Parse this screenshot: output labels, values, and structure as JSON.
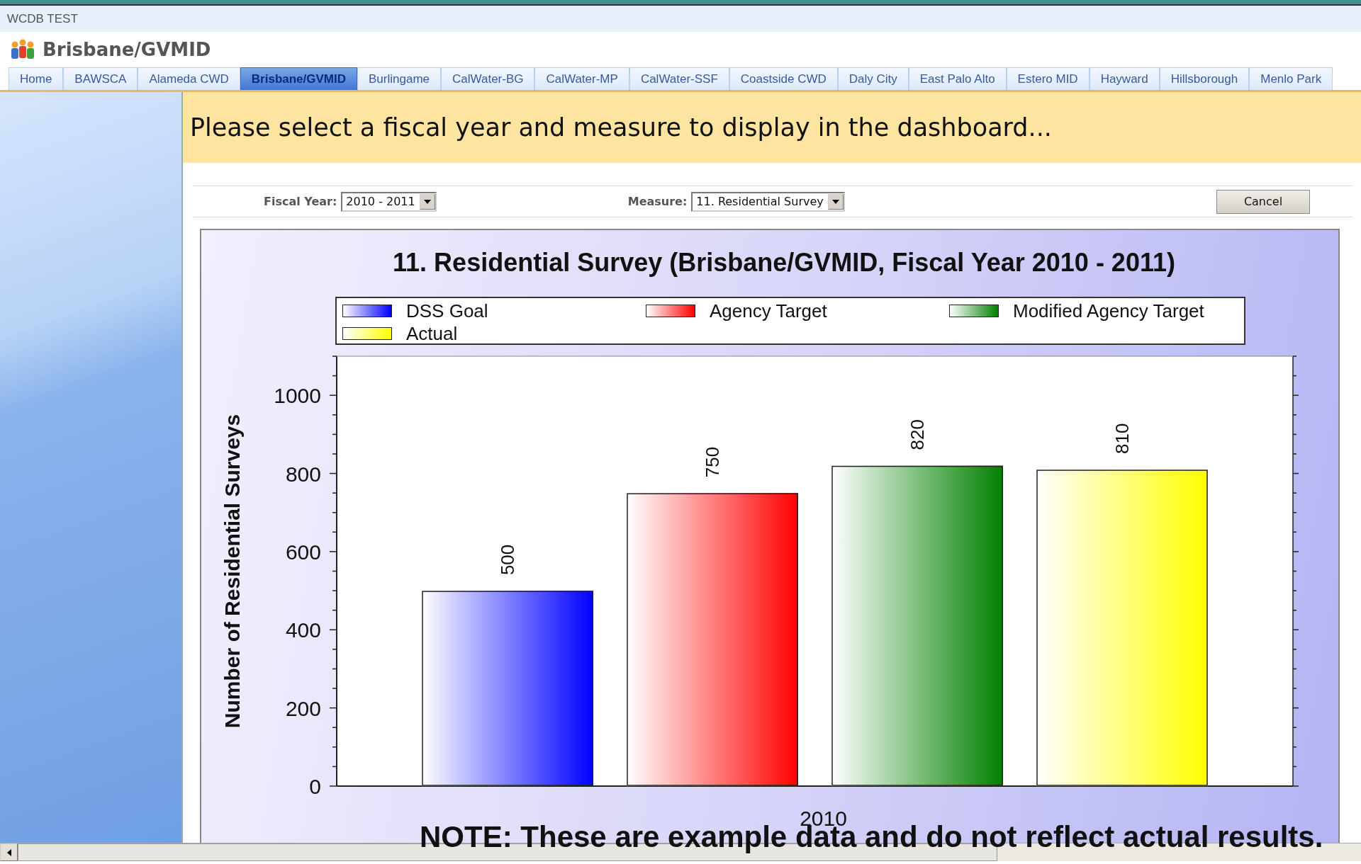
{
  "window": {
    "title": "WCDB TEST"
  },
  "header": {
    "title": "Brisbane/GVMID"
  },
  "tabs": [
    {
      "label": "Home",
      "selected": false
    },
    {
      "label": "BAWSCA",
      "selected": false
    },
    {
      "label": "Alameda CWD",
      "selected": false
    },
    {
      "label": "Brisbane/GVMID",
      "selected": true
    },
    {
      "label": "Burlingame",
      "selected": false
    },
    {
      "label": "CalWater-BG",
      "selected": false
    },
    {
      "label": "CalWater-MP",
      "selected": false
    },
    {
      "label": "CalWater-SSF",
      "selected": false
    },
    {
      "label": "Coastside CWD",
      "selected": false
    },
    {
      "label": "Daly City",
      "selected": false
    },
    {
      "label": "East Palo Alto",
      "selected": false
    },
    {
      "label": "Estero MID",
      "selected": false
    },
    {
      "label": "Hayward",
      "selected": false
    },
    {
      "label": "Hillsborough",
      "selected": false
    },
    {
      "label": "Menlo Park",
      "selected": false
    }
  ],
  "banner": {
    "text": "Please select a fiscal year and measure to display in the dashboard..."
  },
  "filters": {
    "fiscal_year": {
      "label": "Fiscal Year:",
      "value": "2010 - 2011"
    },
    "measure": {
      "label": "Measure:",
      "value": "11. Residential Survey"
    },
    "cancel_button": "Cancel"
  },
  "chart": {
    "chart_data": {
      "type": "bar",
      "title": "11. Residential Survey (Brisbane/GVMID, Fiscal Year 2010 - 2011)",
      "ylabel": "Number of Residential Surveys",
      "categories": [
        "2010"
      ],
      "series": [
        {
          "name": "DSS Goal",
          "color": "#0000ff",
          "values": [
            500
          ]
        },
        {
          "name": "Agency Target",
          "color": "#ff0000",
          "values": [
            750
          ]
        },
        {
          "name": "Modified Agency Target",
          "color": "#008000",
          "values": [
            820
          ]
        },
        {
          "name": "Actual",
          "color": "#ffff00",
          "values": [
            810
          ]
        }
      ],
      "ylim": [
        0,
        1100
      ],
      "yticks": [
        0,
        200,
        400,
        600,
        800,
        1000
      ],
      "data_labels": true
    }
  },
  "note": "NOTE: These are example data and do not reflect actual results."
}
